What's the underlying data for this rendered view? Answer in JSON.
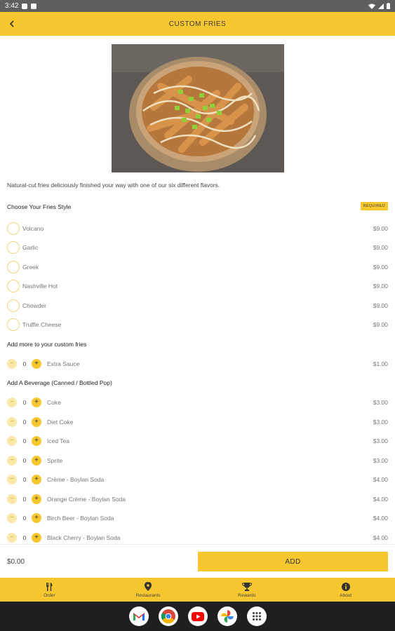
{
  "status_bar": {
    "time": "3:42"
  },
  "header": {
    "back_icon": "chevron-left-icon",
    "title": "CUSTOM FRIES"
  },
  "description": "Natural-cut fries deliciously finished your way with one of our six different flavors.",
  "fries_style": {
    "title": "Choose Your Fries Style",
    "badge": "REQUIRED",
    "options": [
      {
        "label": "Volcano",
        "price": "$9.00"
      },
      {
        "label": "Garlic",
        "price": "$9.00"
      },
      {
        "label": "Greek",
        "price": "$9.00"
      },
      {
        "label": "Nashville Hot",
        "price": "$9.00"
      },
      {
        "label": "Chowder",
        "price": "$9.00"
      },
      {
        "label": "Truffle Cheese",
        "price": "$9.00"
      }
    ]
  },
  "add_more": {
    "title": "Add more to your custom fries",
    "items": [
      {
        "label": "Extra Sauce",
        "qty": "0",
        "price": "$1.00"
      }
    ]
  },
  "beverages": {
    "title": "Add A Beverage (Canned / Bottled Pop)",
    "items": [
      {
        "label": "Coke",
        "qty": "0",
        "price": "$3.00"
      },
      {
        "label": "Diet Coke",
        "qty": "0",
        "price": "$3.00"
      },
      {
        "label": "Iced Tea",
        "qty": "0",
        "price": "$3.00"
      },
      {
        "label": "Sprite",
        "qty": "0",
        "price": "$3.00"
      },
      {
        "label": "Crème - Boylan Soda",
        "qty": "0",
        "price": "$4.00"
      },
      {
        "label": "Orange Crème - Boylan Soda",
        "qty": "0",
        "price": "$4.00"
      },
      {
        "label": "Birch Beer - Boylan Soda",
        "qty": "0",
        "price": "$4.00"
      },
      {
        "label": "Black Cherry - Boylan Soda",
        "qty": "0",
        "price": "$4.00"
      }
    ]
  },
  "stepper": {
    "minus": "−",
    "plus": "+"
  },
  "footer": {
    "total": "$0.00",
    "add_label": "ADD"
  },
  "bottom_nav": [
    {
      "label": "Order",
      "icon": "cutlery-icon"
    },
    {
      "label": "Restaurants",
      "icon": "location-pin-icon"
    },
    {
      "label": "Rewards",
      "icon": "trophy-icon"
    },
    {
      "label": "About",
      "icon": "info-icon"
    }
  ],
  "colors": {
    "accent": "#f7c72f",
    "status_bar": "#5f5f5f",
    "system_nav": "#1f1f1f"
  }
}
